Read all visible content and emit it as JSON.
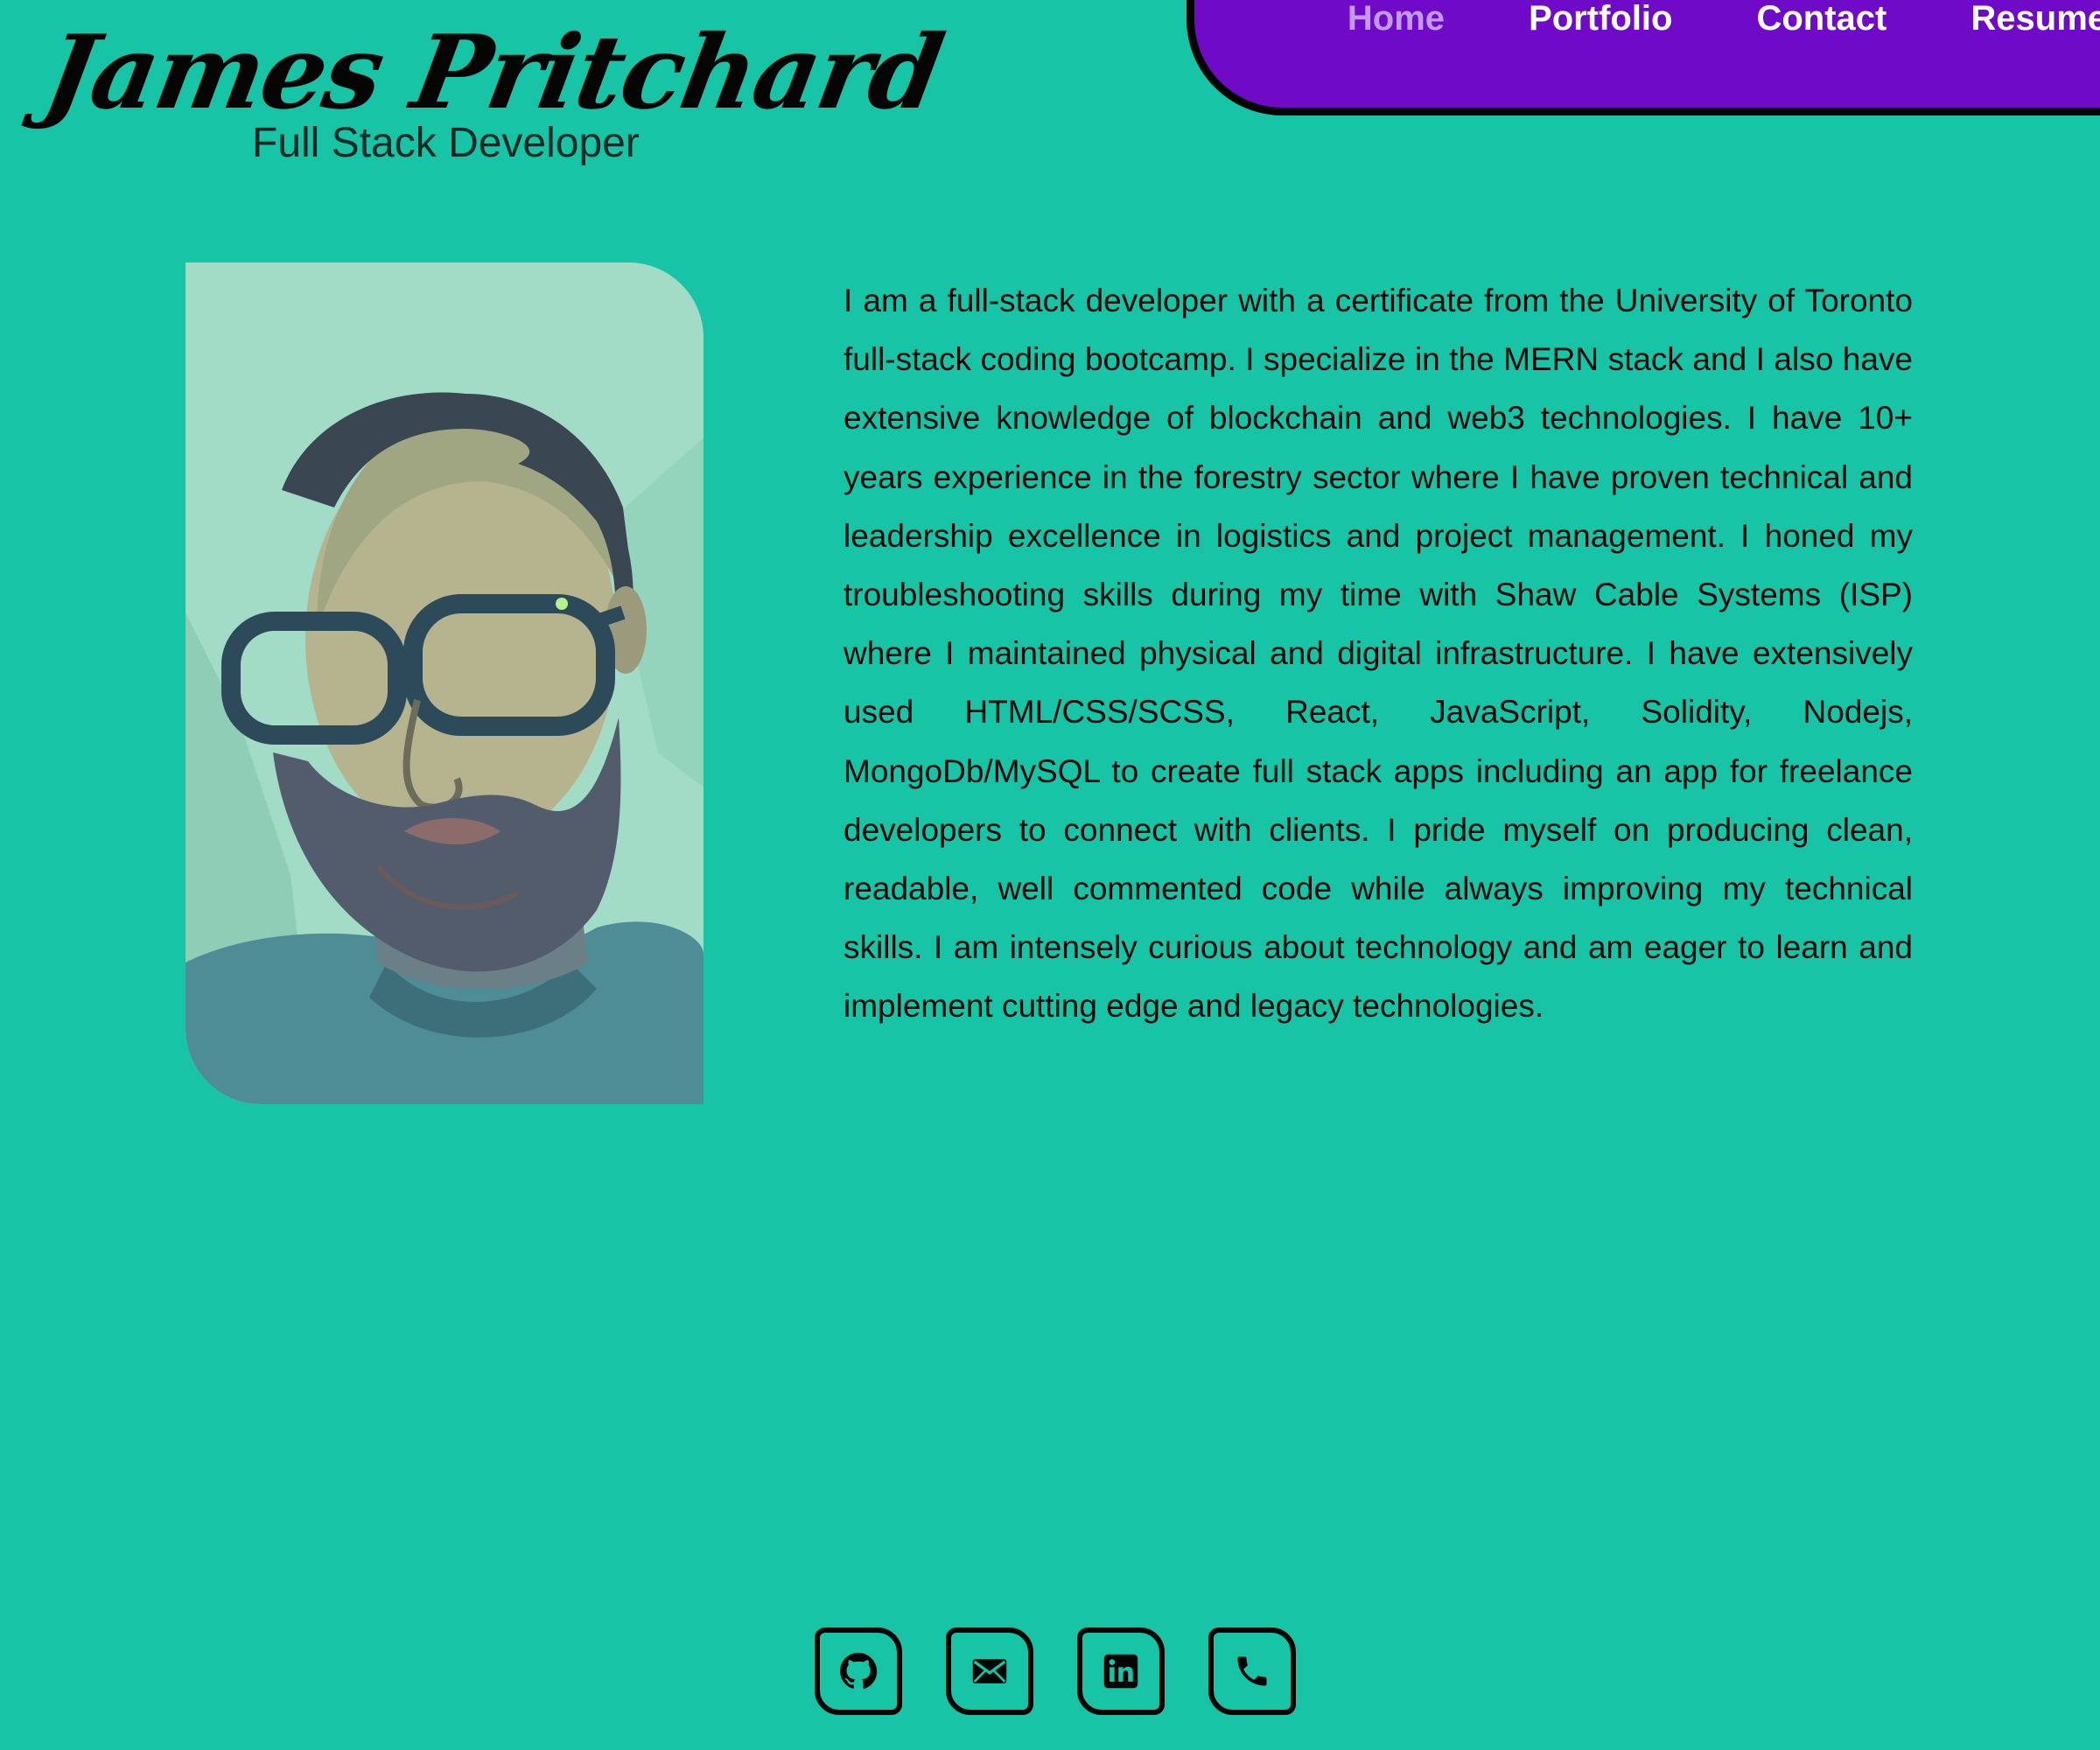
{
  "header": {
    "name": "James Pritchard",
    "role": "Full Stack Developer"
  },
  "nav": {
    "items": [
      {
        "label": "Home",
        "active": true
      },
      {
        "label": "Portfolio",
        "active": false
      },
      {
        "label": "Contact",
        "active": false
      },
      {
        "label": "Resume",
        "active": false
      }
    ]
  },
  "about": {
    "bio": "I am a full-stack developer with a certificate from the University of Toronto full-stack coding bootcamp. I specialize in the MERN stack and I also have extensive knowledge of blockchain and web3 technologies. I have 10+ years experience in the forestry sector where I have proven technical and leadership excellence in logistics and project management. I honed my troubleshooting skills during my time with Shaw Cable Systems (ISP) where I maintained physical and digital infrastructure. I have extensively used HTML/CSS/SCSS, React, JavaScript, Solidity, Nodejs, MongoDb/MySQL to create full stack apps including an app for freelance developers to connect with clients. I pride myself on producing clean, readable, well commented code while always improving my technical skills. I am intensely curious about technology and am eager to learn and implement cutting edge and legacy technologies."
  },
  "social": {
    "icons": [
      "github-icon",
      "email-icon",
      "linkedin-icon",
      "phone-icon"
    ]
  },
  "colors": {
    "background": "#17c4a6",
    "nav_background": "#6f0ac8",
    "nav_active": "#c39af2",
    "nav_text": "#ffffff",
    "text": "#0a0a0a"
  }
}
